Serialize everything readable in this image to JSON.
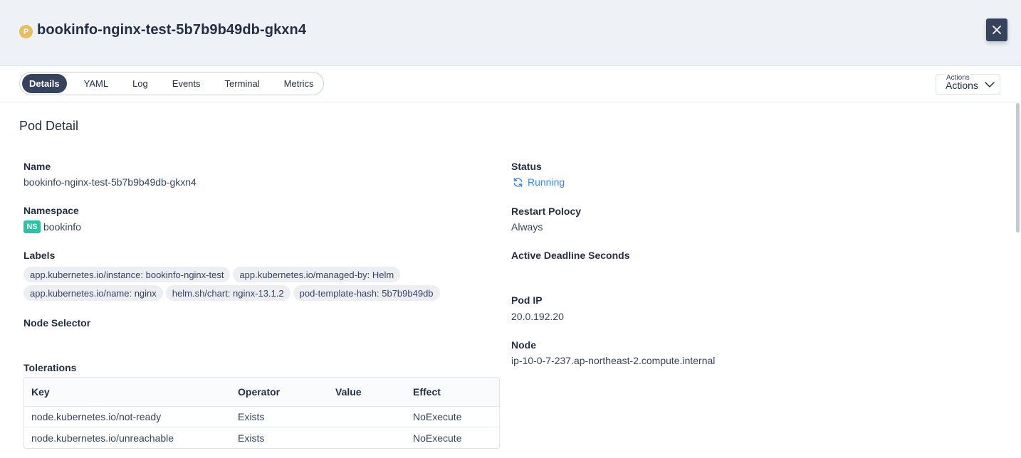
{
  "header": {
    "badge": "P",
    "title": "bookinfo-nginx-test-5b7b9b49db-gkxn4",
    "close_icon": "close-icon"
  },
  "tabs": [
    {
      "label": "Details",
      "active": true
    },
    {
      "label": "YAML",
      "active": false
    },
    {
      "label": "Log",
      "active": false
    },
    {
      "label": "Events",
      "active": false
    },
    {
      "label": "Terminal",
      "active": false
    },
    {
      "label": "Metrics",
      "active": false
    }
  ],
  "actions": {
    "small_label": "Actions",
    "label": "Actions",
    "icon": "chevron-down-icon"
  },
  "section_title": "Pod Detail",
  "left": {
    "name_label": "Name",
    "name_value": "bookinfo-nginx-test-5b7b9b49db-gkxn4",
    "namespace_label": "Namespace",
    "namespace_badge": "NS",
    "namespace_value": "bookinfo",
    "labels_label": "Labels",
    "labels": [
      "app.kubernetes.io/instance: bookinfo-nginx-test",
      "app.kubernetes.io/managed-by: Helm",
      "app.kubernetes.io/name: nginx",
      "helm.sh/chart: nginx-13.1.2",
      "pod-template-hash: 5b7b9b49db"
    ],
    "node_selector_label": "Node Selector",
    "tolerations_label": "Tolerations"
  },
  "tolerations": {
    "headers": [
      "Key",
      "Operator",
      "Value",
      "Effect"
    ],
    "rows": [
      [
        "node.kubernetes.io/not-ready",
        "Exists",
        "",
        "NoExecute"
      ],
      [
        "node.kubernetes.io/unreachable",
        "Exists",
        "",
        "NoExecute"
      ]
    ]
  },
  "right": {
    "status_label": "Status",
    "status_value": "Running",
    "status_icon": "refresh-icon",
    "status_color": "#3385ff",
    "restart_label": "Restart Polocy",
    "restart_value": "Always",
    "deadline_label": "Active Deadline Seconds",
    "pod_ip_label": "Pod IP",
    "pod_ip_value": "20.0.192.20",
    "node_label": "Node",
    "node_value": "ip-10-0-7-237.ap-northeast-2.compute.internal"
  },
  "colors": {
    "header_bg": "#eef2f6",
    "primary_dark": "#36435c",
    "pod_badge": "#e8bd5a",
    "ns_badge": "#2ac4a4"
  }
}
